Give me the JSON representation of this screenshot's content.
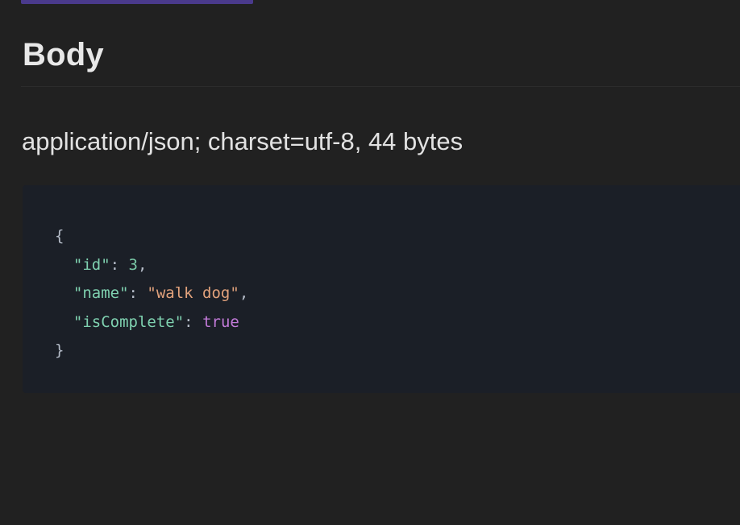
{
  "section": {
    "title": "Body",
    "content_type": "application/json; charset=utf-8, 44 bytes"
  },
  "code": {
    "open_brace": "{",
    "close_brace": "}",
    "lines": [
      {
        "key": "\"id\"",
        "sep": ": ",
        "value": "3",
        "trail": ","
      },
      {
        "key": "\"name\"",
        "sep": ": ",
        "value": "\"walk dog\"",
        "trail": ","
      },
      {
        "key": "\"isComplete\"",
        "sep": ": ",
        "value": "true",
        "trail": ""
      }
    ]
  },
  "colors": {
    "background": "#212121",
    "code_background": "#1b1f27",
    "accent": "#4a3a8c",
    "json_key": "#7fd1b0",
    "json_number": "#79c7a6",
    "json_string": "#e2a27c",
    "json_boolean": "#c27ad8"
  }
}
